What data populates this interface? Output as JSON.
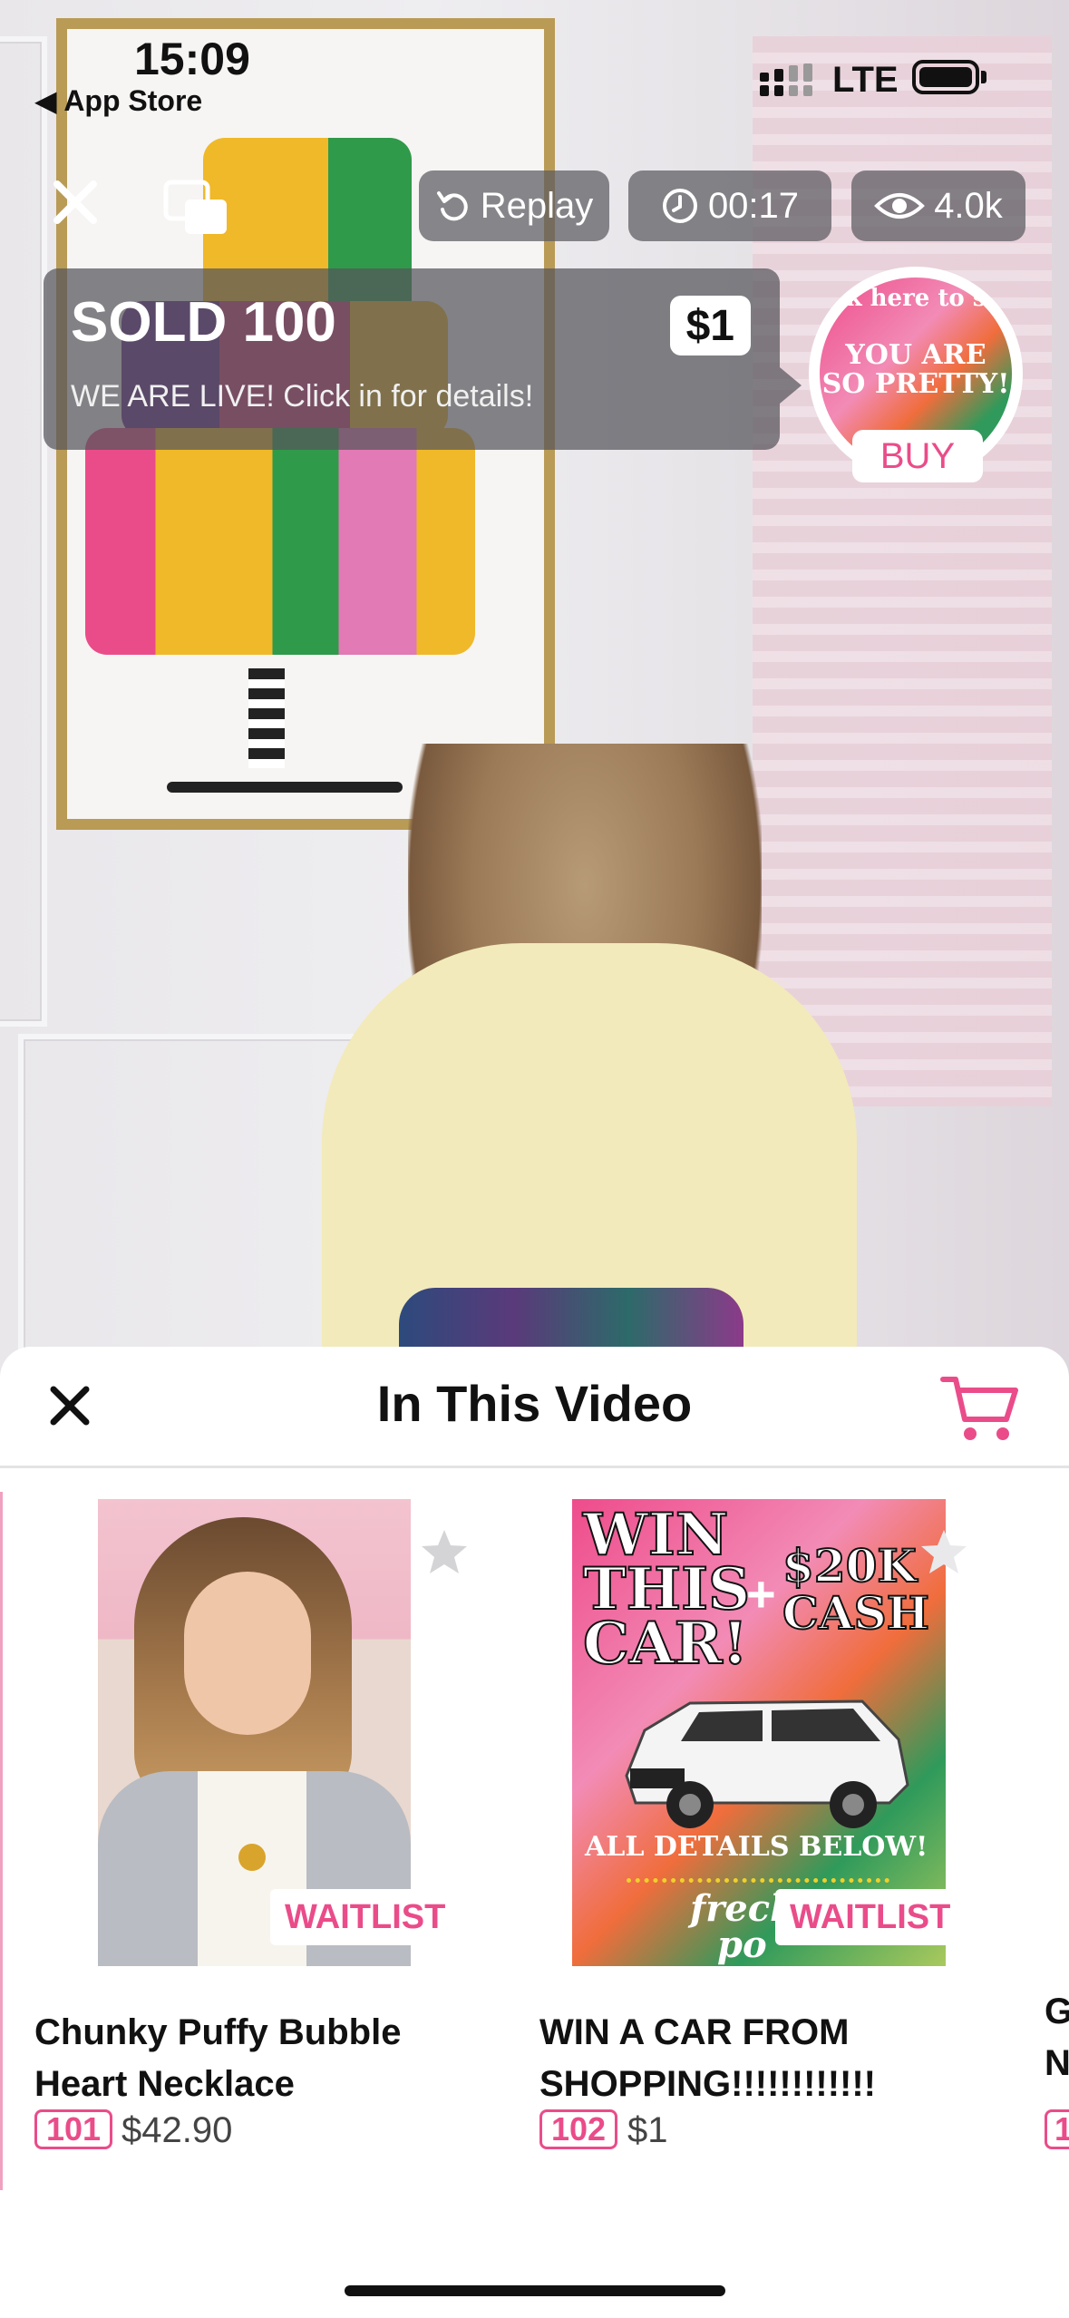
{
  "status_bar": {
    "time": "15:09",
    "back_label": "◀ App Store",
    "network": "LTE"
  },
  "top_controls": {
    "close_icon": "close-icon",
    "pip_icon": "picture-in-picture-icon",
    "replay_label": "Replay",
    "timer": "00:17",
    "viewers": "4.0k"
  },
  "banner": {
    "title": "SOLD 100",
    "subtitle": "WE ARE LIVE! Click in for details!",
    "price": "$1"
  },
  "buy_bubble": {
    "top_text": "k here to s",
    "main_text": "YOU ARE SO PRETTY!",
    "buy_label": "BUY"
  },
  "sheet": {
    "title": "In This Video",
    "products": [
      {
        "name": "Chunky Puffy Bubble Heart Necklace",
        "number": "101",
        "price": "$42.90",
        "badge": "WAITLIST"
      },
      {
        "name": "WIN A CAR FROM SHOPPING!!!!!!!!!!!!",
        "number": "102",
        "price": "$1",
        "badge": "WAITLIST"
      }
    ],
    "peek_letters": [
      "G",
      "N",
      "1"
    ]
  },
  "promo_image": {
    "line1": "WIN",
    "line2": "THIS",
    "line3": "CAR!",
    "plus": "+",
    "cash1": "$20K",
    "cash2": "CASH",
    "details": "ALL DETAILS BELOW!",
    "brand": "freck",
    "brand2": "po"
  },
  "colors": {
    "accent": "#ea4c8a",
    "overlay": "#5a5a60"
  }
}
